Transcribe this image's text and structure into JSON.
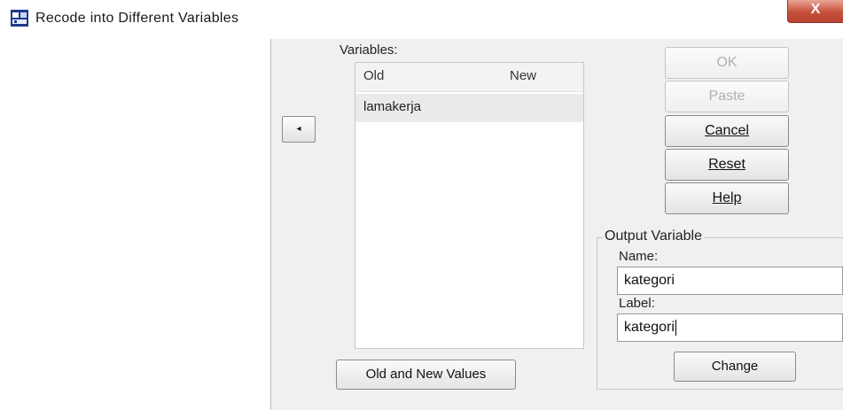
{
  "window": {
    "title": "Recode into Different Variables",
    "close_glyph": "X",
    "icon": "spss-dialog-icon"
  },
  "source_list": {
    "items": []
  },
  "move_button": {
    "glyph": "◂",
    "icon": "arrow-left-icon"
  },
  "variables": {
    "label": "Variables:",
    "columns": {
      "old": "Old",
      "new": "New"
    },
    "rows": [
      {
        "old": "lamakerja",
        "new": ""
      }
    ]
  },
  "buttons": {
    "ok": "OK",
    "paste": "Paste",
    "cancel": "Cancel",
    "reset": "Reset",
    "help": "Help",
    "old_new_values": "Old and New Values",
    "change": "Change"
  },
  "output_variable": {
    "group_title": "Output Variable",
    "name_label": "Name:",
    "name_value": "kategori",
    "label_label": "Label:",
    "label_value": "kategori"
  },
  "colors": {
    "close_button": "#c5503a",
    "dialog_background": "#f0f0f0"
  }
}
